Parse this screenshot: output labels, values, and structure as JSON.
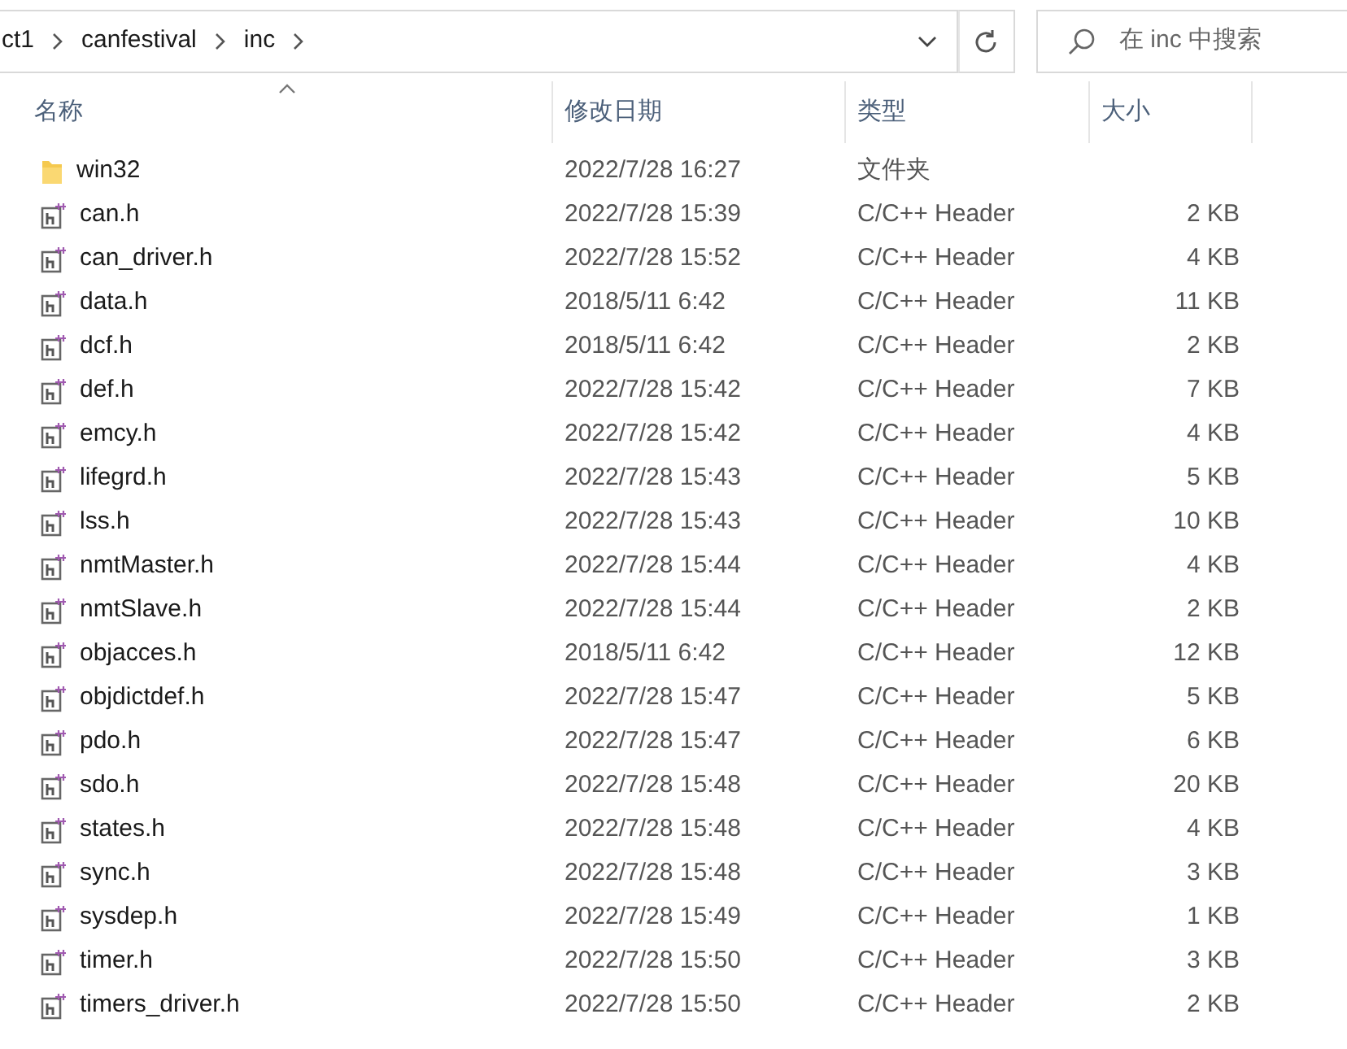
{
  "address_bar": {
    "breadcrumbs": [
      "ct1",
      "canfestival",
      "inc"
    ]
  },
  "search": {
    "placeholder": "在 inc 中搜索"
  },
  "columns": [
    "名称",
    "修改日期",
    "类型",
    "大小"
  ],
  "files": [
    {
      "kind": "folder",
      "name": "win32",
      "modified": "2022/7/28 16:27",
      "type": "文件夹"
    },
    {
      "kind": "header",
      "name": "can.h",
      "modified": "2022/7/28 15:39",
      "type": "C/C++ Header",
      "size": "2 KB"
    },
    {
      "kind": "header",
      "name": "can_driver.h",
      "modified": "2022/7/28 15:52",
      "type": "C/C++ Header",
      "size": "4 KB"
    },
    {
      "kind": "header",
      "name": "data.h",
      "modified": "2018/5/11 6:42",
      "type": "C/C++ Header",
      "size": "11 KB"
    },
    {
      "kind": "header",
      "name": "dcf.h",
      "modified": "2018/5/11 6:42",
      "type": "C/C++ Header",
      "size": "2 KB"
    },
    {
      "kind": "header",
      "name": "def.h",
      "modified": "2022/7/28 15:42",
      "type": "C/C++ Header",
      "size": "7 KB"
    },
    {
      "kind": "header",
      "name": "emcy.h",
      "modified": "2022/7/28 15:42",
      "type": "C/C++ Header",
      "size": "4 KB"
    },
    {
      "kind": "header",
      "name": "lifegrd.h",
      "modified": "2022/7/28 15:43",
      "type": "C/C++ Header",
      "size": "5 KB"
    },
    {
      "kind": "header",
      "name": "lss.h",
      "modified": "2022/7/28 15:43",
      "type": "C/C++ Header",
      "size": "10 KB"
    },
    {
      "kind": "header",
      "name": "nmtMaster.h",
      "modified": "2022/7/28 15:44",
      "type": "C/C++ Header",
      "size": "4 KB"
    },
    {
      "kind": "header",
      "name": "nmtSlave.h",
      "modified": "2022/7/28 15:44",
      "type": "C/C++ Header",
      "size": "2 KB"
    },
    {
      "kind": "header",
      "name": "objacces.h",
      "modified": "2018/5/11 6:42",
      "type": "C/C++ Header",
      "size": "12 KB"
    },
    {
      "kind": "header",
      "name": "objdictdef.h",
      "modified": "2022/7/28 15:47",
      "type": "C/C++ Header",
      "size": "5 KB"
    },
    {
      "kind": "header",
      "name": "pdo.h",
      "modified": "2022/7/28 15:47",
      "type": "C/C++ Header",
      "size": "6 KB"
    },
    {
      "kind": "header",
      "name": "sdo.h",
      "modified": "2022/7/28 15:48",
      "type": "C/C++ Header",
      "size": "20 KB"
    },
    {
      "kind": "header",
      "name": "states.h",
      "modified": "2022/7/28 15:48",
      "type": "C/C++ Header",
      "size": "4 KB"
    },
    {
      "kind": "header",
      "name": "sync.h",
      "modified": "2022/7/28 15:48",
      "type": "C/C++ Header",
      "size": "3 KB"
    },
    {
      "kind": "header",
      "name": "sysdep.h",
      "modified": "2022/7/28 15:49",
      "type": "C/C++ Header",
      "size": "1 KB"
    },
    {
      "kind": "header",
      "name": "timer.h",
      "modified": "2022/7/28 15:50",
      "type": "C/C++ Header",
      "size": "3 KB"
    },
    {
      "kind": "header",
      "name": "timers_driver.h",
      "modified": "2022/7/28 15:50",
      "type": "C/C++ Header",
      "size": "2 KB"
    }
  ]
}
